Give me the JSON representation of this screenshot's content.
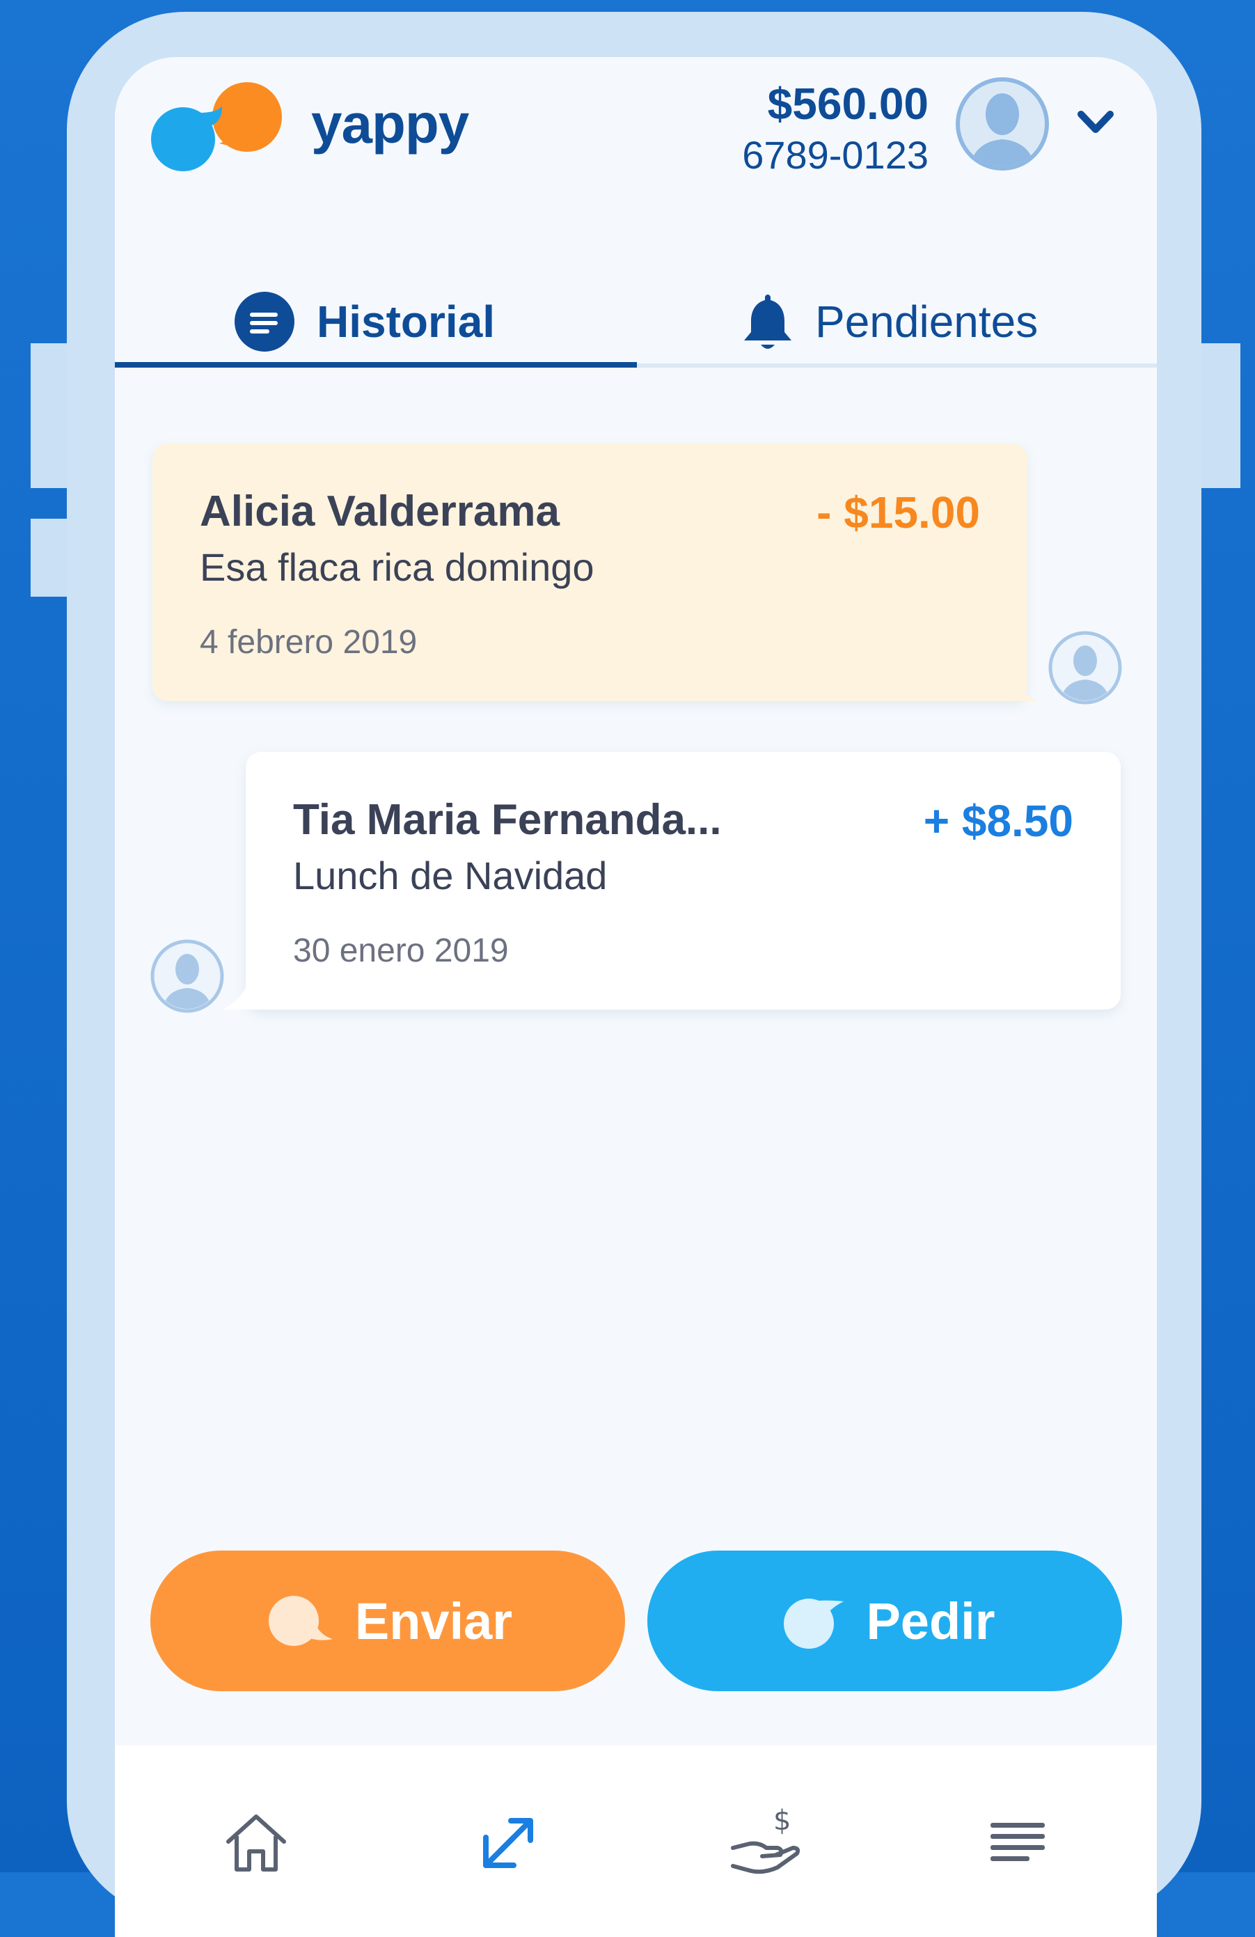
{
  "header": {
    "brand": "yappy",
    "balance": "$560.00",
    "phone": "6789-0123",
    "logo_icon": "yappy-speech-bubbles-logo",
    "avatar_icon": "user-avatar-icon",
    "menu_icon": "chevron-down-icon"
  },
  "tabs": [
    {
      "label": "Historial",
      "icon": "list-circle-icon",
      "active": true
    },
    {
      "label": "Pendientes",
      "icon": "bell-icon",
      "active": false
    }
  ],
  "transactions": [
    {
      "name": "Alicia Valderrama",
      "description": "Esa flaca rica domingo",
      "date": "4 febrero 2019",
      "amount": "- $15.00",
      "type": "sent"
    },
    {
      "name": "Tia Maria Fernanda...",
      "description": "Lunch de Navidad",
      "date": "30 enero 2019",
      "amount": "+ $8.50",
      "type": "received"
    }
  ],
  "actions": {
    "send_label": "Enviar",
    "request_label": "Pedir"
  },
  "bottom_nav": [
    {
      "icon": "home-icon",
      "active": false
    },
    {
      "icon": "transfer-arrows-icon",
      "active": true
    },
    {
      "icon": "hand-dollar-icon",
      "active": false
    },
    {
      "icon": "menu-lines-icon",
      "active": false
    }
  ],
  "colors": {
    "brand_blue": "#0f4c97",
    "send_orange": "#fe973c",
    "request_blue": "#20aef1",
    "debit_orange": "#f7881f",
    "credit_blue": "#1a7fe0"
  }
}
